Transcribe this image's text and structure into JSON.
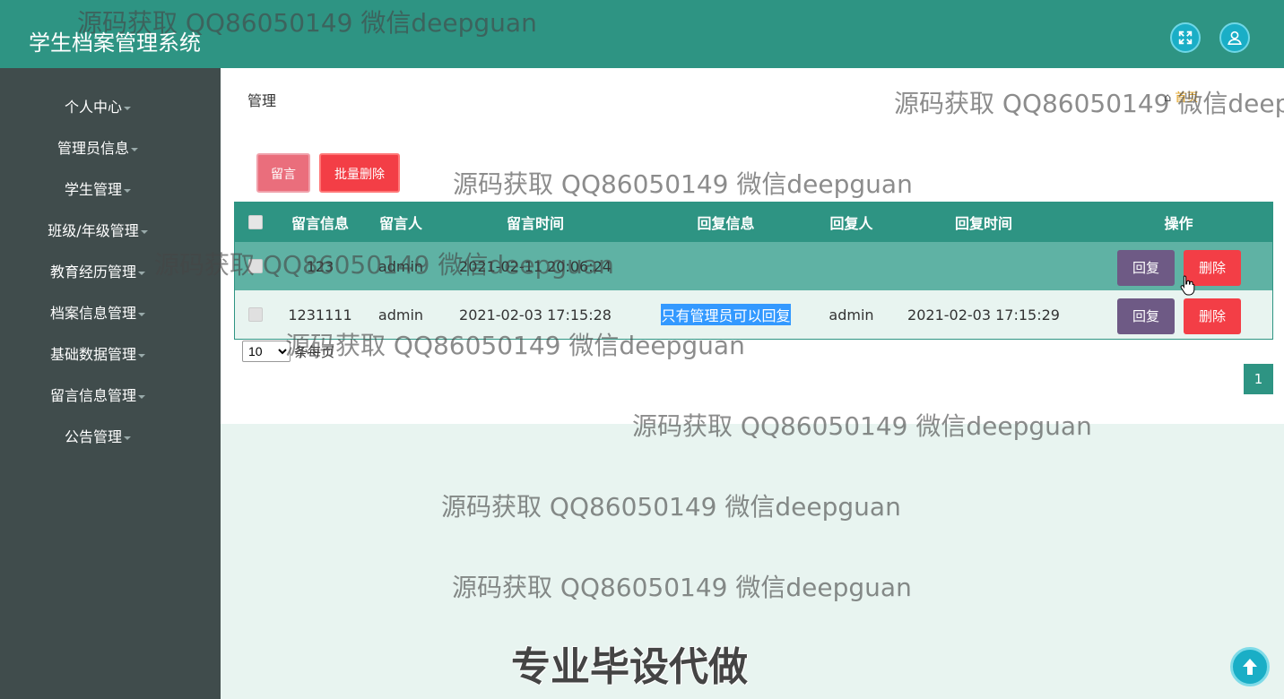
{
  "app": {
    "title": "学生档案管理系统",
    "accent": "#2e9483",
    "sidebar_bg": "#404c4c"
  },
  "topbar": {
    "fullscreen_icon": "fullscreen-icon",
    "user_icon": "user-icon"
  },
  "sidebar": {
    "items": [
      {
        "label": "个人中心"
      },
      {
        "label": "管理员信息"
      },
      {
        "label": "学生管理"
      },
      {
        "label": "班级/年级管理"
      },
      {
        "label": "教育经历管理"
      },
      {
        "label": "档案信息管理"
      },
      {
        "label": "基础数据管理"
      },
      {
        "label": "留言信息管理"
      },
      {
        "label": "公告管理"
      }
    ]
  },
  "breadcrumb": {
    "title": "管理",
    "home_text": "首页"
  },
  "toolbar": {
    "message_label": "留言",
    "batch_delete_label": "批量删除"
  },
  "table": {
    "headers": [
      "留言信息",
      "留言人",
      "留言时间",
      "回复信息",
      "回复人",
      "回复时间",
      "操作"
    ],
    "rows": [
      {
        "message": "123",
        "author": "admin",
        "time": "2021-02-11 20:06:24",
        "reply": "",
        "replier": "",
        "reply_time": "",
        "reply_btn": "回复",
        "delete_btn": "删除"
      },
      {
        "message": "1231111",
        "author": "admin",
        "time": "2021-02-03 17:15:28",
        "reply": "只有管理员可以回复",
        "replier": "admin",
        "reply_time": "2021-02-03 17:15:29",
        "reply_btn": "回复",
        "delete_btn": "删除"
      }
    ]
  },
  "pagination": {
    "page_size": "10",
    "page_size_label": "条每页",
    "current_page": "1"
  },
  "watermarks": {
    "text": "源码获取 QQ86050149 微信deepguan",
    "promo": "专业毕设代做"
  }
}
